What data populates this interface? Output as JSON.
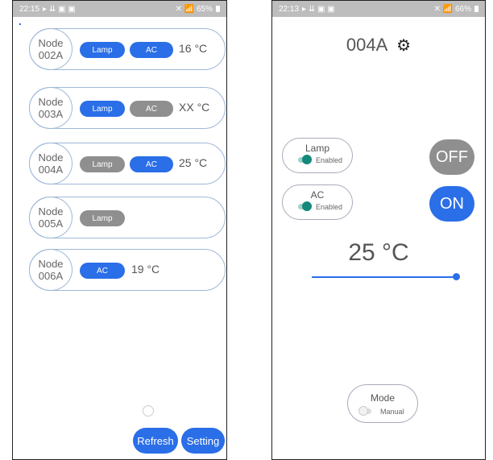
{
  "left": {
    "status": {
      "time": "22:15",
      "icons": "▸ ⇊ ▣ ▣",
      "right": "✕ 📶 65%"
    },
    "nodes": [
      {
        "name": "Node\n002A",
        "pills": [
          {
            "label": "Lamp",
            "state": "on"
          },
          {
            "label": "AC",
            "state": "on"
          }
        ],
        "temp": "16 °C"
      },
      {
        "name": "Node\n003A",
        "pills": [
          {
            "label": "Lamp",
            "state": "on"
          },
          {
            "label": "AC",
            "state": "off"
          }
        ],
        "temp": "XX °C"
      },
      {
        "name": "Node\n004A",
        "pills": [
          {
            "label": "Lamp",
            "state": "off"
          },
          {
            "label": "AC",
            "state": "on"
          }
        ],
        "temp": "25 °C"
      },
      {
        "name": "Node\n005A",
        "pills": [
          {
            "label": "Lamp",
            "state": "off"
          }
        ],
        "temp": ""
      },
      {
        "name": "Node\n006A",
        "pills": [
          {
            "label": "AC",
            "state": "on"
          }
        ],
        "temp": "19 °C"
      }
    ],
    "buttons": {
      "refresh": "Refresh",
      "setting": "Setting"
    }
  },
  "right": {
    "status": {
      "time": "22:13",
      "icons": "▸ ⇊ ▣ ▣",
      "right": "✕ 📶 66%"
    },
    "title": "004A",
    "settings_icon": "⚙",
    "devices": [
      {
        "name": "Lamp",
        "switch_label": "Enabled",
        "state_button": "OFF",
        "state": "off"
      },
      {
        "name": "AC",
        "switch_label": "Enabled",
        "state_button": "ON",
        "state": "on"
      }
    ],
    "temperature": "25 °C",
    "mode": {
      "name": "Mode",
      "switch_label": "Manual"
    }
  },
  "colors": {
    "accent": "#2a6ee8",
    "inactive": "#8f8f8f",
    "toggle": "#14897a"
  }
}
